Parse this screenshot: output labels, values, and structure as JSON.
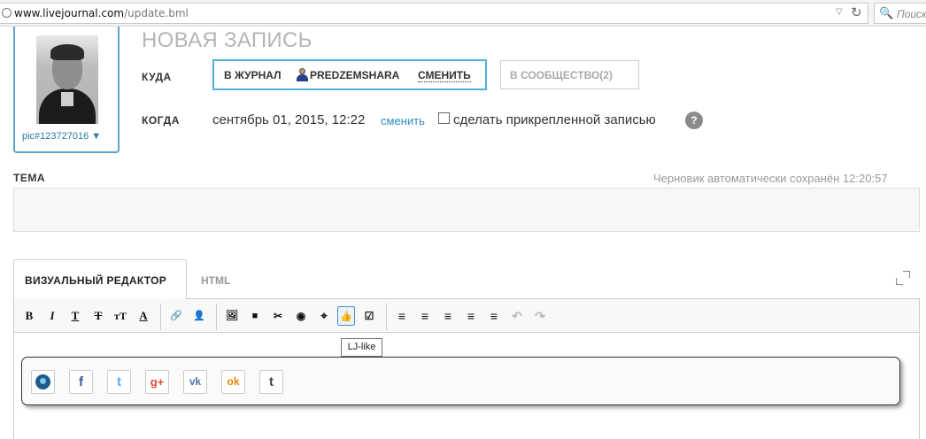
{
  "browser": {
    "url_domain": "www.livejournal.com",
    "url_path": "/update.bml",
    "search_placeholder": "Поиск"
  },
  "userpic": {
    "label": "pic#123727016 ▼"
  },
  "page": {
    "title": "НОВАЯ ЗАПИСЬ"
  },
  "where": {
    "label": "КУДА",
    "journal_prefix": "В ЖУРНАЛ",
    "username": "PREDZEMSHARA",
    "change_label": "СМЕНИТЬ",
    "community_label": "В СООБЩЕСТВО(2)"
  },
  "when": {
    "label": "КОГДА",
    "date": "сентябрь 01, 2015, 12:22",
    "change_link": "сменить",
    "sticky_label": "сделать прикрепленной записью",
    "help": "?"
  },
  "subject": {
    "label": "ТЕМА",
    "value": "",
    "draft_status": "Черновик автоматически сохранён 12:20:57"
  },
  "editor": {
    "tab_visual": "ВИЗУАЛЬНЫЙ РЕДАКТОР",
    "tab_html": "HTML",
    "tooltip": "LJ-like",
    "toolbar": {
      "bold": "B",
      "italic": "I",
      "underline": "T",
      "strike": "T",
      "fontsize": "тТ",
      "color": "A",
      "link": "🔗",
      "user": "👤",
      "image": "🖼",
      "video": "■",
      "cut": "✂",
      "spoiler": "◉",
      "location": "⌖",
      "like": "👍",
      "poll": "☑",
      "ol": "≡",
      "ul": "≡",
      "align_left": "≡",
      "align_center": "≡",
      "align_right": "≡",
      "undo": "↶",
      "redo": "↷"
    },
    "share_buttons": {
      "lj": "",
      "facebook": "f",
      "twitter": "t",
      "gplus": "g+",
      "vk": "vk",
      "ok": "ok",
      "tumblr": "t"
    }
  },
  "colors": {
    "accent": "#4fb3d9",
    "link": "#2c8bc4",
    "facebook": "#3b5998",
    "twitter": "#55acee",
    "gplus": "#dd4b39",
    "vk": "#4c75a3",
    "ok": "#ee8208",
    "tumblr": "#35465c"
  }
}
